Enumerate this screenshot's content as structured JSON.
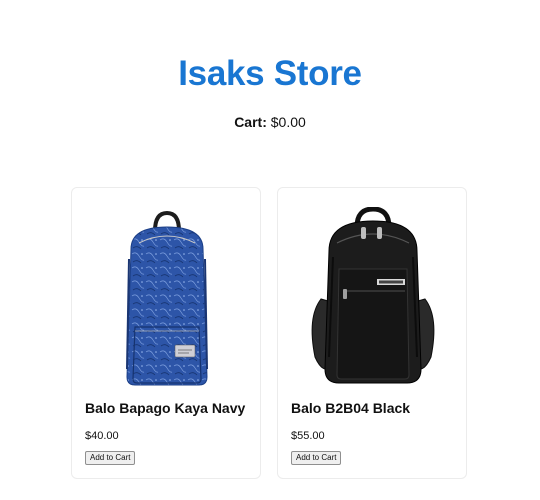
{
  "store": {
    "title": "Isaks Store"
  },
  "cart": {
    "label": "Cart:",
    "total": "$0.00"
  },
  "products": [
    {
      "name": "Balo Bapago Kaya Navy",
      "price": "$40.00",
      "button_label": "Add to Cart",
      "image_icon": "navy-backpack-image",
      "color": "#2b4f9e"
    },
    {
      "name": "Balo B2B04 Black",
      "price": "$55.00",
      "button_label": "Add to Cart",
      "image_icon": "black-backpack-image",
      "color": "#1a1a1a"
    }
  ],
  "colors": {
    "accent": "#1976d2"
  }
}
